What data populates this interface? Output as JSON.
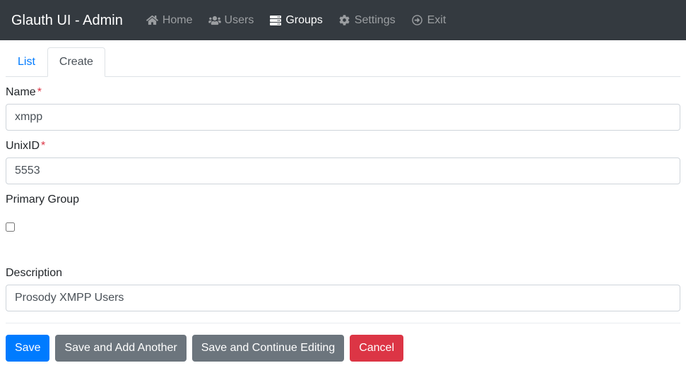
{
  "navbar": {
    "brand": "Glauth UI - Admin",
    "background": "#343a40",
    "items": [
      {
        "label": "Home",
        "icon": "home-icon",
        "active": false
      },
      {
        "label": "Users",
        "icon": "users-icon",
        "active": false
      },
      {
        "label": "Groups",
        "icon": "server-icon",
        "active": true
      },
      {
        "label": "Settings",
        "icon": "gear-icon",
        "active": false
      },
      {
        "label": "Exit",
        "icon": "sign-out-icon",
        "active": false
      }
    ]
  },
  "tabs": [
    {
      "label": "List",
      "active": false
    },
    {
      "label": "Create",
      "active": true
    }
  ],
  "form": {
    "name": {
      "label": "Name",
      "required_marker": "*",
      "value": "xmpp",
      "placeholder": "Name"
    },
    "unixid": {
      "label": "UnixID",
      "required_marker": "*",
      "value": "5553",
      "placeholder": "UnixID"
    },
    "primary_group": {
      "label": "Primary Group",
      "checked": false
    },
    "description": {
      "label": "Description",
      "value": "Prosody XMPP Users",
      "placeholder": "Description"
    }
  },
  "buttons": {
    "save": "Save",
    "save_and_add_another": "Save and Add Another",
    "save_and_continue_editing": "Save and Continue Editing",
    "cancel": "Cancel"
  },
  "colors": {
    "navbar_bg": "#343a40",
    "primary": "#007bff",
    "secondary": "#6c757d",
    "danger": "#dc3545",
    "required_star": "#dc3545",
    "input_border": "#ced4da"
  }
}
